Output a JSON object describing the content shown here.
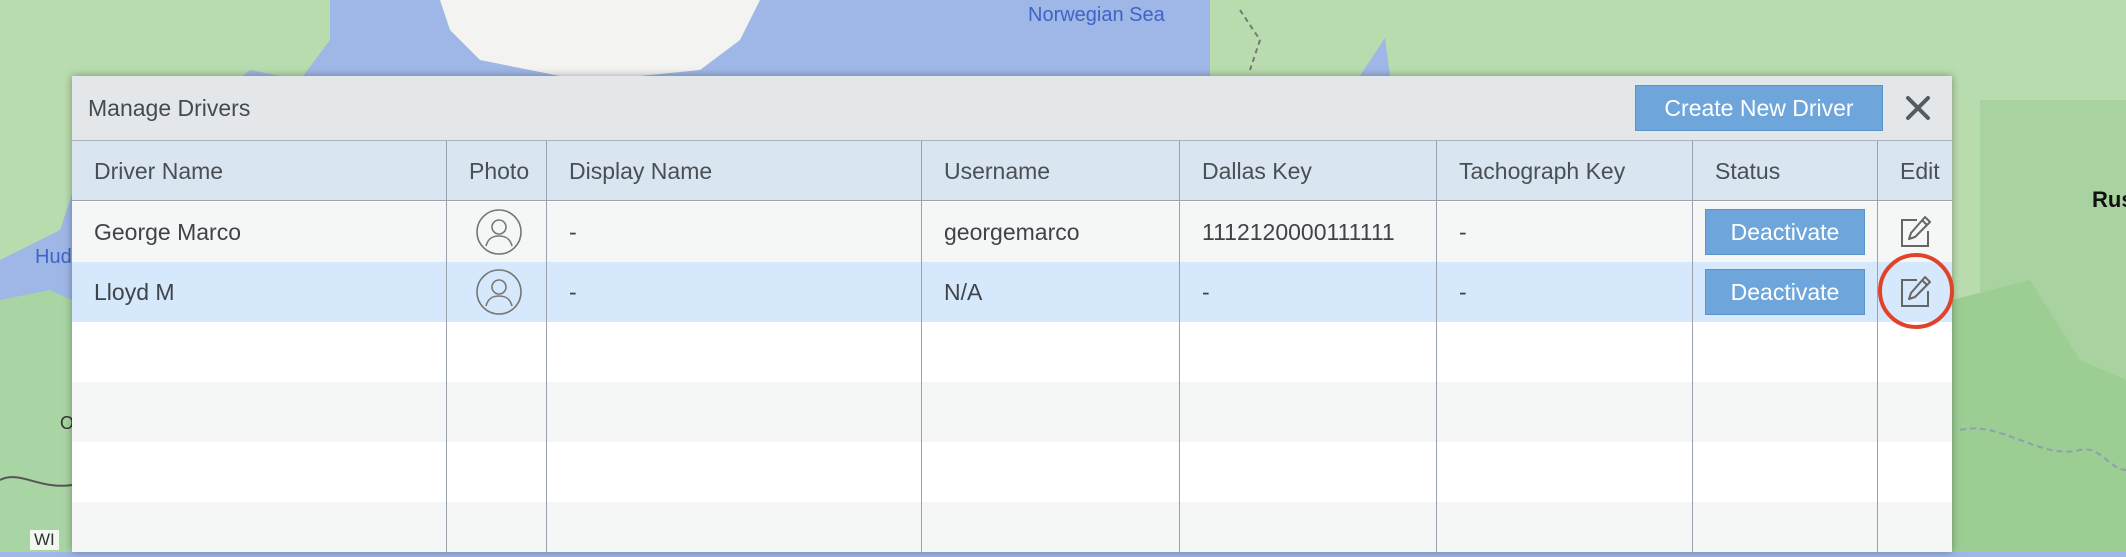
{
  "map": {
    "labels": {
      "sea": "Norwegian Sea",
      "hudson": "Hud",
      "russia": "Rus",
      "o": "O",
      "wi": "WI"
    },
    "colors": {
      "water": "#9fb7e6",
      "land": "#a9d4a4",
      "ice": "#f3f3f1"
    }
  },
  "dialog": {
    "title": "Manage Drivers",
    "create_button": "Create New Driver",
    "close_icon": "close-icon"
  },
  "table": {
    "columns": [
      "Driver Name",
      "Photo",
      "Display Name",
      "Username",
      "Dallas Key",
      "Tachograph Key",
      "Status",
      "Edit"
    ],
    "rows": [
      {
        "driver_name": "George Marco",
        "photo": "avatar-icon",
        "display_name": "-",
        "username": "georgemarco",
        "dallas_key": "1112120000111111",
        "tachograph_key": "-",
        "status_button": "Deactivate",
        "edit": "edit-icon"
      },
      {
        "driver_name": "Lloyd M",
        "photo": "avatar-icon",
        "display_name": "-",
        "username": "N/A",
        "dallas_key": "-",
        "tachograph_key": "-",
        "status_button": "Deactivate",
        "edit": "edit-icon"
      }
    ]
  },
  "colors": {
    "accent_button": "#6ea6dc",
    "header_bg": "#d9e5f1",
    "selected_row": "#d6e8fb",
    "highlight_ring": "#e0422a"
  }
}
